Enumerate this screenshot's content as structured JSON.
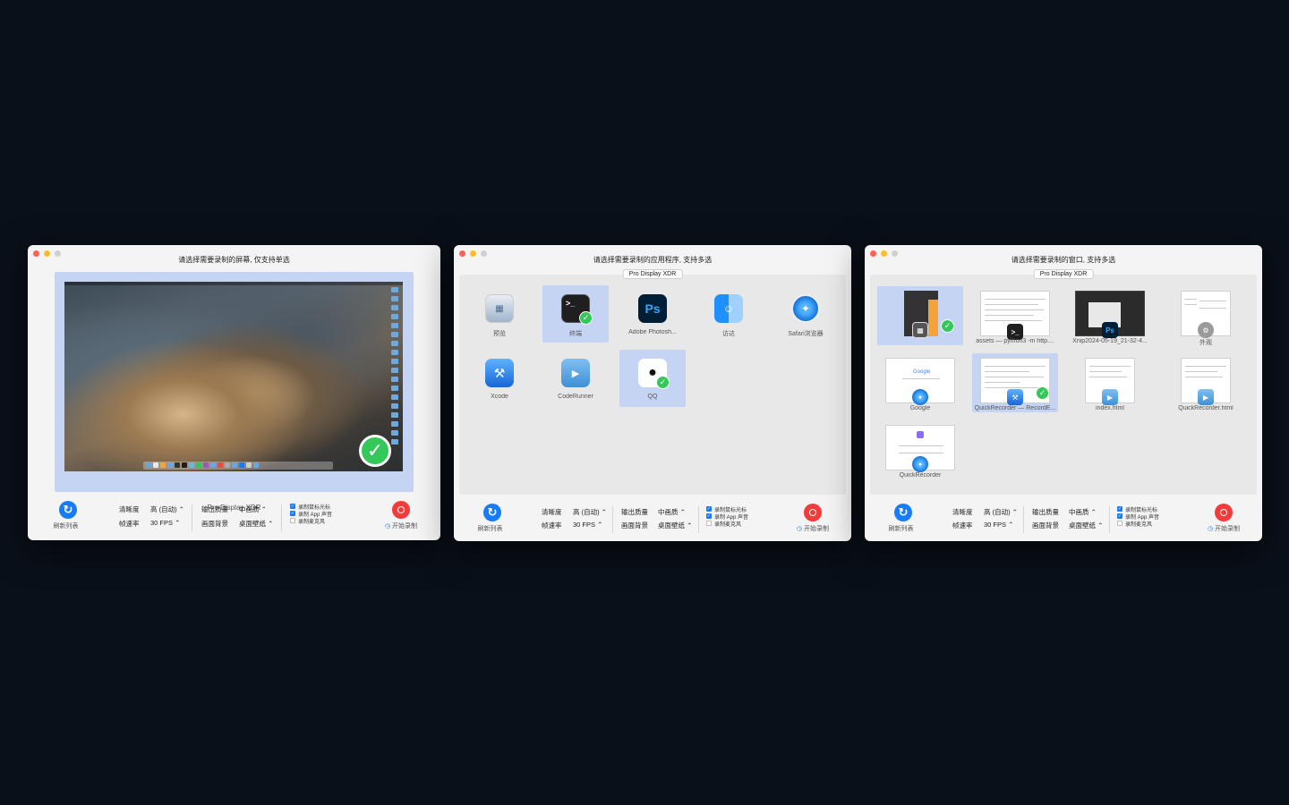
{
  "colors": {
    "accent": "#1a7cf5",
    "record": "#f33b3b",
    "selection": "#c5d4f3",
    "check": "#34c759"
  },
  "display_label": "Pro Display XDR",
  "footer": {
    "refresh_label": "刷新列表",
    "clarity_label": "清晰度",
    "clarity_value": "高 (自动) ⌃",
    "fps_label": "帧速率",
    "fps_value": "30 FPS ⌃",
    "quality_label": "输出质量",
    "quality_value": "中画质 ⌃",
    "background_label": "画面背景",
    "background_value": "桌面壁纸 ⌃",
    "record_cursor": "录制鼠标光标",
    "record_app_audio": "录制 App 声音",
    "record_mic": "录制麦克风",
    "start_label": "开始录制"
  },
  "screen_window": {
    "title": "请选择需要录制的屏幕, 仅支持单选",
    "screen_name": "Pro Display XDR"
  },
  "app_window": {
    "title": "请选择需要录制的应用程序, 支持多选",
    "apps": [
      {
        "name": "预览",
        "icon": "preview-icon",
        "selected": false
      },
      {
        "name": "终端",
        "icon": "terminal-icon",
        "selected": true
      },
      {
        "name": "Adobe Photosh...",
        "icon": "photoshop-icon",
        "selected": false
      },
      {
        "name": "访达",
        "icon": "finder-icon",
        "selected": false
      },
      {
        "name": "Safari浏览器",
        "icon": "safari-icon",
        "selected": false
      },
      {
        "name": "Xcode",
        "icon": "xcode-icon",
        "selected": false
      },
      {
        "name": "CodeRunner",
        "icon": "coderunner-icon",
        "selected": false
      },
      {
        "name": "QQ",
        "icon": "qq-icon",
        "selected": true
      }
    ]
  },
  "window_window": {
    "title": "请选择需要录制的窗口, 支持多选",
    "windows": [
      {
        "name": "",
        "app": "calculator-icon",
        "selected": true
      },
      {
        "name": "assets — python3 -m http....",
        "app": "terminal-icon",
        "selected": false
      },
      {
        "name": "Xnip2024-05-19_21-32-4...",
        "app": "photoshop-icon",
        "selected": false
      },
      {
        "name": "外观",
        "app": "settings-icon",
        "selected": false
      },
      {
        "name": "Google",
        "app": "safari-icon",
        "selected": false
      },
      {
        "name": "QuickRecorder — RecordE...",
        "app": "xcode-icon",
        "selected": true
      },
      {
        "name": "index.html",
        "app": "coderunner-icon",
        "selected": false
      },
      {
        "name": "QuickRecorder.html",
        "app": "coderunner-icon",
        "selected": false
      },
      {
        "name": "QuickRecorder",
        "app": "safari-icon",
        "selected": false
      }
    ]
  }
}
